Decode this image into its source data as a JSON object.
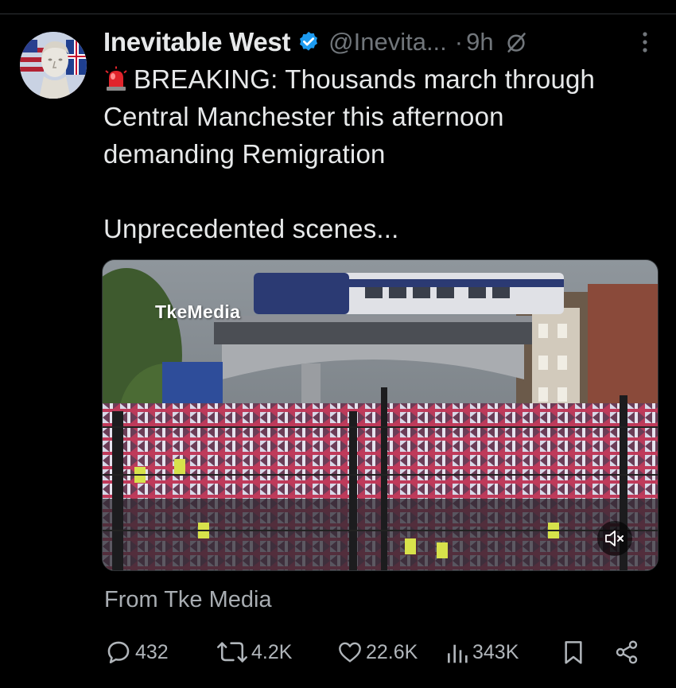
{
  "tweet": {
    "display_name": "Inevitable West",
    "handle": "@Inevita...",
    "separator": "·",
    "time": "9h",
    "lines": [
      "BREAKING: Thousands march through",
      "Central Manchester this afternoon",
      "demanding Remigration"
    ],
    "line_extra": "Unprecedented scenes...",
    "media": {
      "watermark": "TkeMedia"
    },
    "source": "From Tke Media"
  },
  "metrics": {
    "replies": "432",
    "reposts": "4.2K",
    "likes": "22.6K",
    "views": "343K"
  },
  "icons": {
    "verified": "verified-badge-icon",
    "grok": "grok-icon",
    "more": "more-options-icon",
    "siren": "siren-emoji-icon",
    "mute": "volume-muted-icon",
    "reply": "reply-icon",
    "repost": "repost-icon",
    "like": "heart-icon",
    "views": "analytics-icon",
    "bookmark": "bookmark-icon",
    "share": "share-icon"
  },
  "colors": {
    "background": "#000000",
    "text": "#e7e9ea",
    "secondary": "#71767b",
    "verified": "#1d9bf0"
  }
}
